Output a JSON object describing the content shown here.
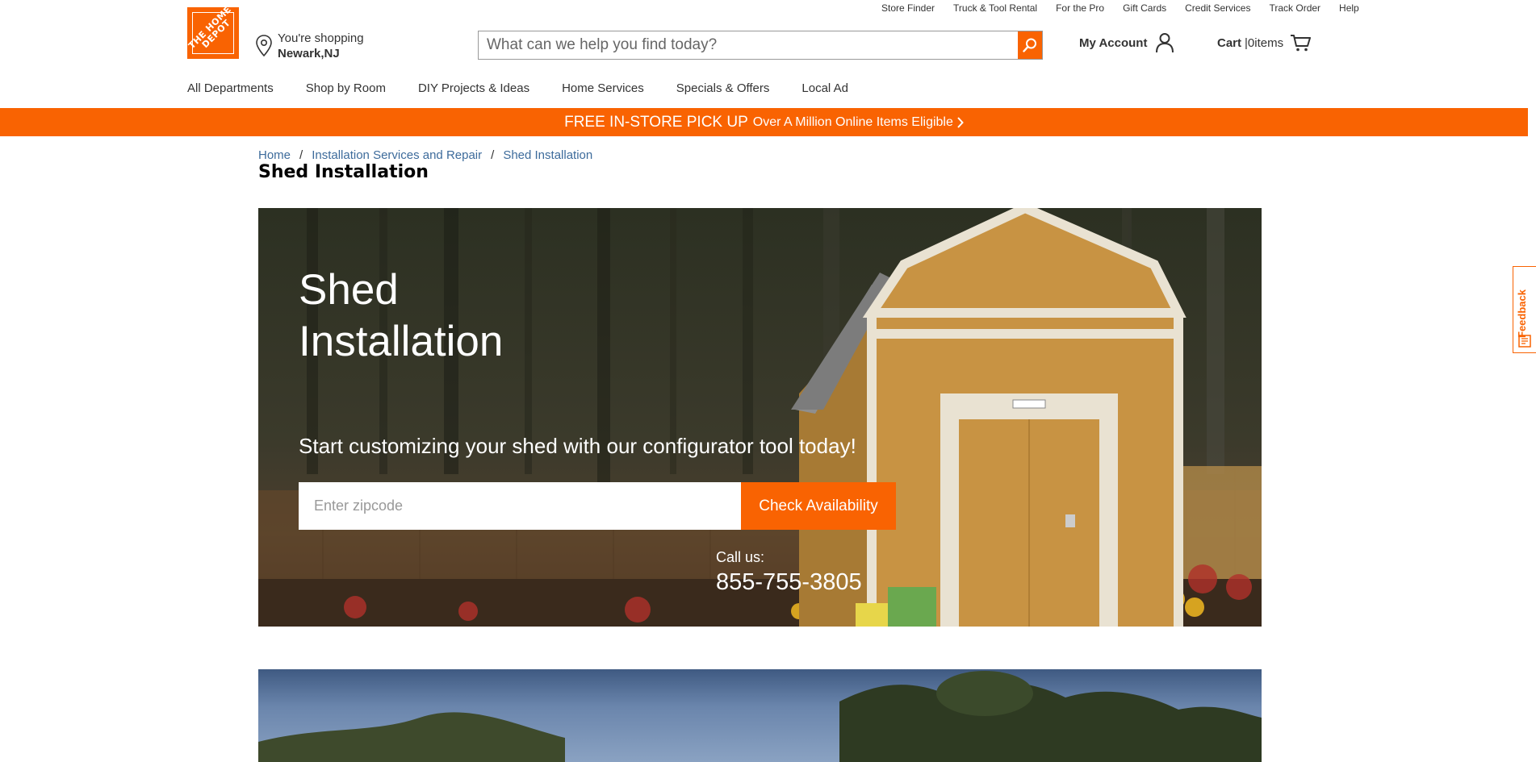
{
  "header": {
    "logo_text": "THE HOME DEPOT",
    "location_prefix": "You're shopping",
    "location_city": "Newark,NJ",
    "search_placeholder": "What can we help you find today?",
    "account_label": "My Account",
    "cart_label": "Cart",
    "cart_count": "|0items",
    "utility_links": [
      "Store Finder",
      "Truck & Tool Rental",
      "For the Pro",
      "Gift Cards",
      "Credit Services",
      "Track Order",
      "Help"
    ],
    "nav_items": [
      "All Departments",
      "Shop by Room",
      "DIY Projects & Ideas",
      "Home Services",
      "Specials & Offers",
      "Local Ad"
    ]
  },
  "promo": {
    "main": "FREE IN-STORE PICK UP",
    "sub": "Over A Million Online Items Eligible"
  },
  "breadcrumb": [
    "Home",
    "Installation Services and Repair",
    "Shed Installation"
  ],
  "page_title": "Shed Installation",
  "hero": {
    "title_line1": "Shed",
    "title_line2": "Installation",
    "subtitle": "Start customizing your shed with our configurator tool today!",
    "zip_placeholder": "Enter zipcode",
    "cta_label": "Check Availability",
    "call_label": "Call us:",
    "phone": "855-755-3805"
  },
  "feedback_label": "Feedback",
  "colors": {
    "brand_orange": "#f96302",
    "link_blue": "#3d6b9b"
  },
  "icons": [
    "location-pin-icon",
    "search-icon",
    "user-icon",
    "cart-icon",
    "chevron-right-icon",
    "feedback-icon"
  ]
}
